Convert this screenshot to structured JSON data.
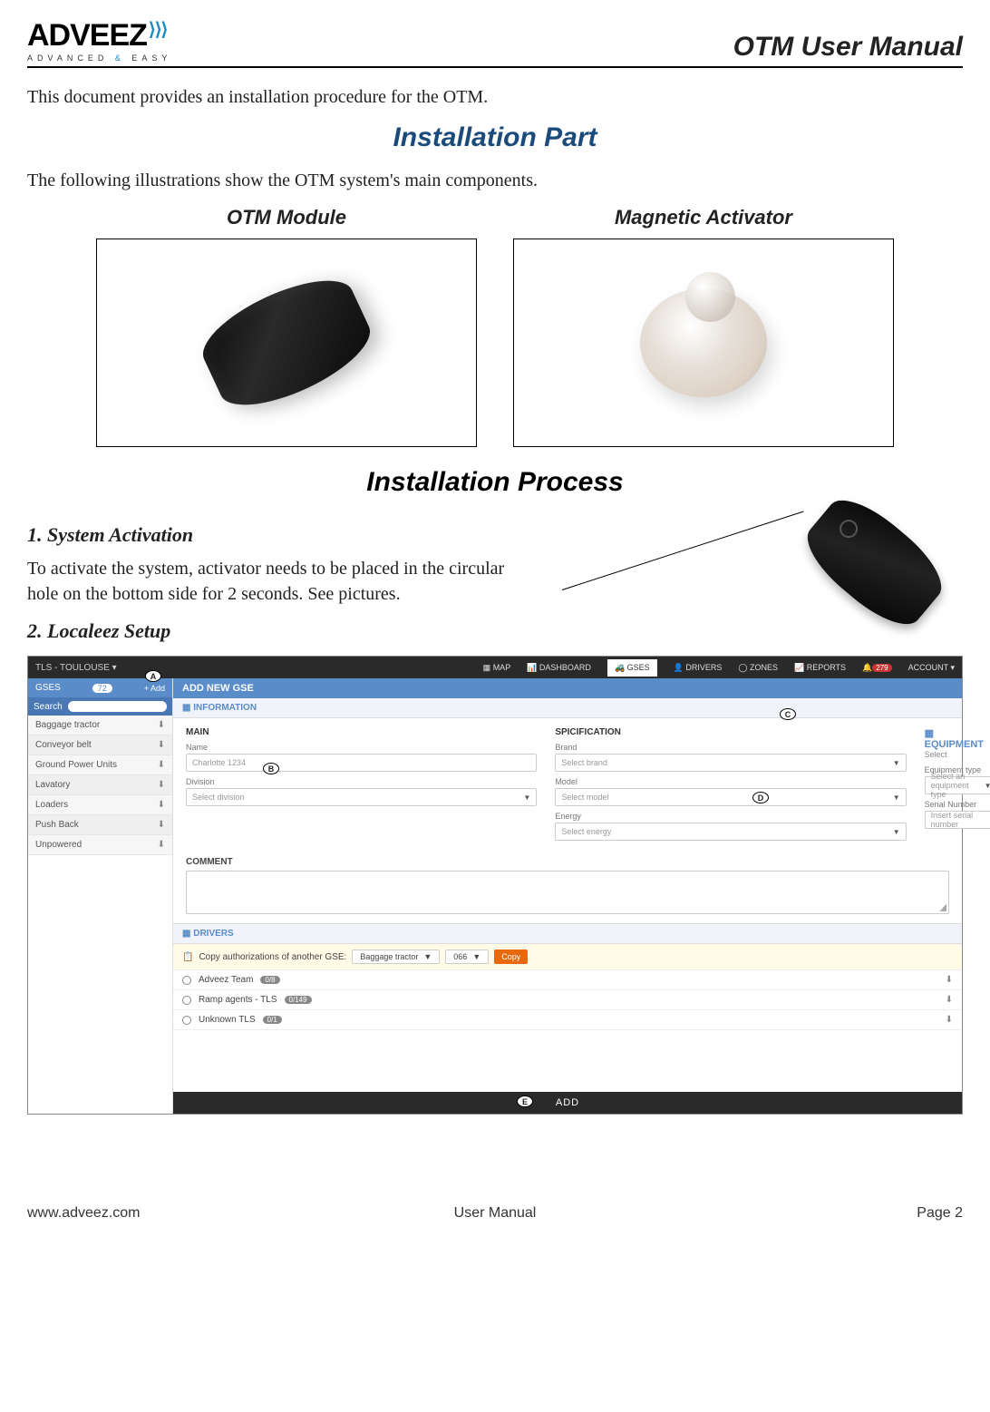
{
  "header": {
    "logo_main": "ADVEEZ",
    "logo_sub_left": "ADVANCED",
    "logo_sub_amp": "&",
    "logo_sub_right": "EASY",
    "doc_title": "OTM User Manual"
  },
  "intro": "This document provides an installation procedure for the OTM.",
  "section_installation_part": "Installation Part",
  "illus_intro": "The following illustrations show the OTM system's main components.",
  "components": {
    "otm_title": "OTM Module",
    "activator_title": "Magnetic Activator"
  },
  "section_installation_process": "Installation Process",
  "step1": {
    "title": "1. System Activation",
    "text": "To activate the system, activator needs to be placed in the circular hole on the bottom side for 2 seconds. See pictures."
  },
  "step2": {
    "title": "2. Localeez Setup"
  },
  "screenshot": {
    "topbar": {
      "site": "TLS - TOULOUSE ▾",
      "nav": {
        "map": "MAP",
        "dashboard": "DASHBOARD",
        "gses": "GSES",
        "drivers": "DRIVERS",
        "zones": "ZONES",
        "reports": "REPORTS",
        "account": "ACCOUNT ▾"
      },
      "badge": "279"
    },
    "side": {
      "head": "GSES",
      "count": "72",
      "add": "+ Add",
      "search": "Search",
      "items": [
        "Baggage tractor",
        "Conveyor belt",
        "Ground Power Units",
        "Lavatory",
        "Loaders",
        "Push Back",
        "Unpowered"
      ]
    },
    "main": {
      "add_bar": "ADD NEW GSE",
      "info_bar": "INFORMATION",
      "col1_title": "MAIN",
      "name_label": "Name",
      "name_ph": "Charlotte 1234",
      "division_label": "Division",
      "division_ph": "Select division",
      "col2_title": "SPICIFICATION",
      "brand_label": "Brand",
      "brand_ph": "Select brand",
      "model_label": "Model",
      "model_ph": "Select model",
      "energy_label": "Energy",
      "energy_ph": "Select energy",
      "equip_title": "EQUIPMENT",
      "equip_select": "✎ Select",
      "equip_type_label": "Equipment type",
      "equip_type_ph": "Select an equipment type",
      "serial_label": "Serial Number",
      "serial_ph": "Insert serial number",
      "comment_label": "COMMENT",
      "drivers_bar": "DRIVERS",
      "copy_label": "Copy authorizations of another GSE:",
      "copy_sel1": "Baggage tractor",
      "copy_sel2": "066",
      "copy_btn": "Copy",
      "drv": [
        {
          "name": "Adveez Team",
          "badge": "0/8"
        },
        {
          "name": "Ramp agents - TLS",
          "badge": "0/149"
        },
        {
          "name": "Unknown TLS",
          "badge": "0/1"
        }
      ],
      "add_btn": "ADD"
    },
    "callouts": {
      "a": "A",
      "b": "B",
      "c": "C",
      "d": "D",
      "e": "E"
    }
  },
  "footer": {
    "left": "www.adveez.com",
    "center": "User Manual",
    "right": "Page 2"
  }
}
